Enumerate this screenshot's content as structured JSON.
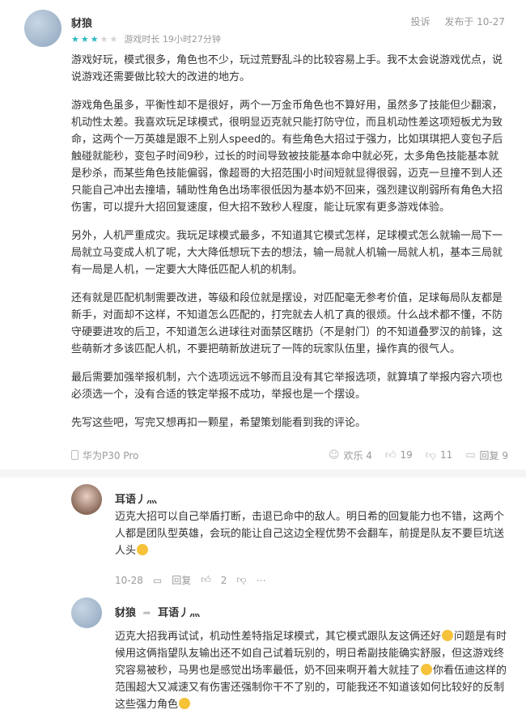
{
  "review": {
    "author": "豺狼",
    "actions": {
      "report": "投诉",
      "published": "发布于 10-27"
    },
    "rating": 3,
    "playtime": "游戏时长 19小时27分钟",
    "paragraphs": [
      "游戏好玩，模式很多，角色也不少，玩过荒野乱斗的比较容易上手。我不太会说游戏优点，说说游戏还需要做比较大的改进的地方。",
      "游戏角色虽多，平衡性却不是很好，两个一万金币角色也不算好用，虽然多了技能但少翻滚，机动性太差。我喜欢玩足球模式，很明显迈克就只能打防守位，而且机动性差这项短板尤为致命，这两个一万英雄是跟不上别人speed的。有些角色大招过于强力，比如琪琪把人变包子后触碰就能秒，变包子时间9秒，过长的时间导致被技能基本命中就必死，太多角色技能基本就是秒杀，而某些角色技能偏弱，像超哥的大招范围小时间短就显得很弱，迈克一旦撞不到人还只能自己冲出去撞墙，辅助性角色出场率很低因为基本奶不回来，强烈建议削弱所有角色大招伤害，可以提升大招回复速度，但大招不致秒人程度，能让玩家有更多游戏体验。",
      "另外，人机严重成灾。我玩足球模式最多，不知道其它模式怎样，足球模式怎么就输一局下一局就立马变成人机了呢，大大降低想玩下去的想法，输一局就人机输一局就人机，基本三局就有一局是人机，一定要大大降低匹配人机的机制。",
      "还有就是匹配机制需要改进，等级和段位就是摆设，对匹配毫无参考价值，足球每局队友都是新手，对面却不这样，不知道怎么匹配的，打完就去人机了真的很烦。什么战术都不懂，不防守硬要进攻的后卫，不知道怎么进球往对面禁区瞎扔（不是射门）的不知道叠罗汉的前锋，这些萌新才多该匹配人机，不要把萌新放进玩了一阵的玩家队伍里，操作真的很气人。",
      "最后需要加强举报机制，六个选项远远不够而且没有其它举报选项，就算填了举报内容六项也必须选一个，没有合适的铁定举报不成功，举报也是一个摆设。",
      "先写这些吧，写完又想再扣一颗星，希望策划能看到我的评论。"
    ],
    "device": "华为P30 Pro",
    "stats": {
      "happy": "欢乐 4",
      "likes": "19",
      "dislikes": "11",
      "replies": "回复 9"
    }
  },
  "replies": [
    {
      "name": "耳语丿灬",
      "text_before": "迈克大招可以自己举盾打断，击退已命中的敌人。明日希的回复能力也不错，这两个人都是团队型英雄，会玩的能让自己这边全程优势不会翻车，前提是队友不要巨坑送人头",
      "date": "10-28",
      "reply_label": "回复",
      "likes": "2"
    },
    {
      "name": "豺狼",
      "to": "耳语丿灬",
      "text1": "迈克大招我再试试，机动性差特指足球模式，其它模式跟队友这俩还好",
      "text2": "问题是有时候用这俩指望队友输出还不如自己试着玩别的，明日希副技能确实舒服，但这游戏终究容易被秒，马男也是感觉出场率最低，奶不回来啊开着大就挂了",
      "text3": "你看伍迪这样的范围超大又减速又有伤害还强制你干不了别的，可能我还不知道该如何比较好的反制这些强力角色"
    }
  ]
}
